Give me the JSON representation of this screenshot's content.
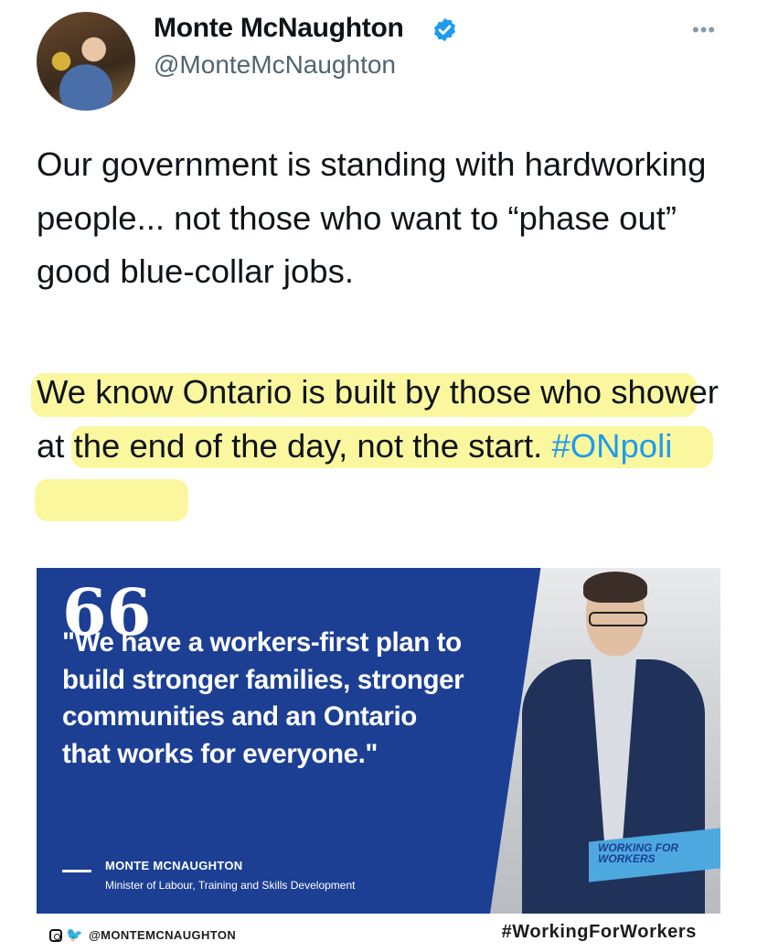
{
  "author": {
    "display_name": "Monte McNaughton",
    "handle": "@MonteMcNaughton",
    "verified_icon": "verified-badge-icon",
    "more_label": "•••"
  },
  "tweet": {
    "paragraph1": "Our government is standing with hardworking people... not those who want to “phase out” good blue-collar jobs.",
    "paragraph2_text": "We know Ontario is built by those who shower at the end of the day, not the start.",
    "hashtag": "#ONpoli",
    "highlight_color": "#f5f050"
  },
  "media": {
    "quote_mark": "66",
    "quote": "\"We have a workers-first plan to build stronger families, stronger communities and an Ontario that works for everyone.\"",
    "attribution_name": "MONTE MCNAUGHTON",
    "attribution_title": "Minister of Labour, Training and Skills Development",
    "podium_text": "WORKING FOR WORKERS",
    "social_handle": "@MONTEMCNAUGHTON",
    "footer_hashtag": "#WorkingForWorkers",
    "panel_color": "#1c3f94",
    "accent_color": "#4ea8e0"
  }
}
